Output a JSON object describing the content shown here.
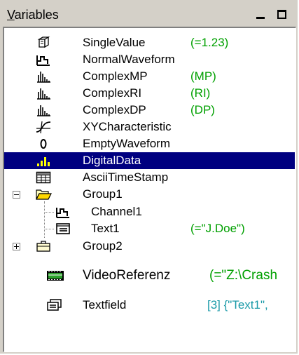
{
  "window": {
    "title_prefix": "V",
    "title_rest": "ariables",
    "minimize_icon": "minimize-icon",
    "maximize_icon": "maximize-icon"
  },
  "items": [
    {
      "label": "SingleValue",
      "value": "(=1.23)",
      "icon": "cube-icon"
    },
    {
      "label": "NormalWaveform",
      "value": "",
      "icon": "waveform-icon"
    },
    {
      "label": "ComplexMP",
      "value": "(MP)",
      "icon": "complex-waveform-icon"
    },
    {
      "label": "ComplexRI",
      "value": "(RI)",
      "icon": "complex-waveform-icon"
    },
    {
      "label": "ComplexDP",
      "value": "(DP)",
      "icon": "complex-waveform-icon"
    },
    {
      "label": "XYCharacteristic",
      "value": "",
      "icon": "xy-curve-icon"
    },
    {
      "label": "EmptyWaveform",
      "value": "",
      "icon": "empty-waveform-icon"
    },
    {
      "label": "DigitalData",
      "value": "",
      "icon": "digital-data-icon",
      "selected": true
    },
    {
      "label": "AsciiTimeStamp",
      "value": "",
      "icon": "timestamp-grid-icon"
    },
    {
      "label": "Group1",
      "value": "",
      "icon": "open-folder-icon",
      "expanded": true
    },
    {
      "label": "Channel1",
      "value": "",
      "icon": "waveform-icon",
      "child": true
    },
    {
      "label": "Text1",
      "value": "(=\"J.Doe\")",
      "icon": "text-card-icon",
      "child": true
    },
    {
      "label": "Group2",
      "value": "",
      "icon": "closed-folder-icon",
      "expanded": false
    },
    {
      "label": "VideoReferenz",
      "value": "(=\"Z:\\Crash",
      "icon": "video-icon"
    },
    {
      "label": "Textfield",
      "value": "[3] {\"Text1\",",
      "icon": "textfield-icon"
    }
  ],
  "colors": {
    "selection": "#000080",
    "value_green": "#00a000",
    "value_teal": "#1a9aa8"
  }
}
